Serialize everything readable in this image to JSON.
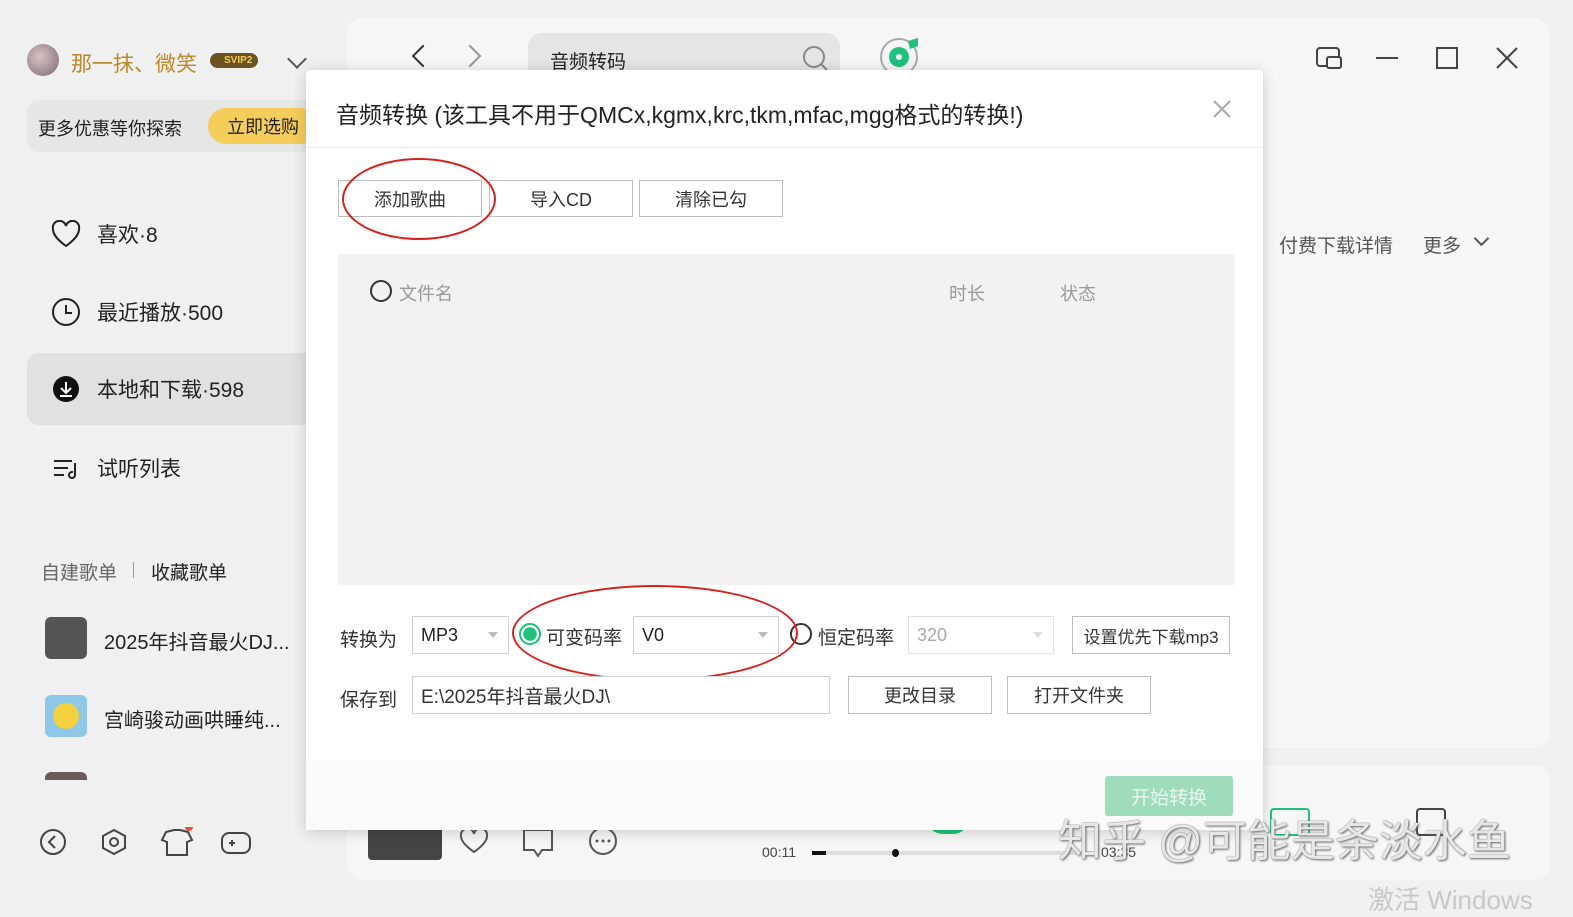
{
  "user": {
    "name": "那一抹、微笑",
    "badge": "SVIP2"
  },
  "promo": {
    "text": "更多优惠等你探索",
    "button": "立即选购"
  },
  "sidebar": {
    "items": [
      {
        "label": "喜欢·8"
      },
      {
        "label": "最近播放·500"
      },
      {
        "label": "本地和下载·598"
      },
      {
        "label": "试听列表"
      }
    ],
    "playlist_tabs": [
      "自建歌单",
      "收藏歌单"
    ],
    "playlists": [
      {
        "label": "2025年抖音最火DJ..."
      },
      {
        "label": "宫崎骏动画哄睡纯..."
      }
    ]
  },
  "search": {
    "value": "音频转码"
  },
  "main": {
    "paid_details": "付费下载详情",
    "more": "更多"
  },
  "dialog": {
    "title": "音频转换 (该工具不用于QMCx,kgmx,krc,tkm,mfac,mgg格式的转换!)",
    "buttons": {
      "add": "添加歌曲",
      "import_cd": "导入CD",
      "clear": "清除已勾"
    },
    "columns": {
      "filename": "文件名",
      "duration": "时长",
      "status": "状态"
    },
    "convert_label": "转换为",
    "format": "MP3",
    "vbr_label": "可变码率",
    "vbr_value": "V0",
    "cbr_label": "恒定码率",
    "cbr_value": "320",
    "set_priority": "设置优先下载mp3",
    "save_label": "保存到",
    "save_path": "E:\\2025年抖音最火DJ\\",
    "change_dir": "更改目录",
    "open_folder": "打开文件夹",
    "start": "开始转换"
  },
  "player": {
    "elapsed": "00:11",
    "total": "03:35",
    "progress": 0.05
  },
  "watermark": "知乎 @可能是条淡水鱼",
  "activation": "激活 Windows",
  "colors": {
    "accent": "#1ec27a",
    "annotation": "#d8201c",
    "gold": "#f5cd5a"
  }
}
